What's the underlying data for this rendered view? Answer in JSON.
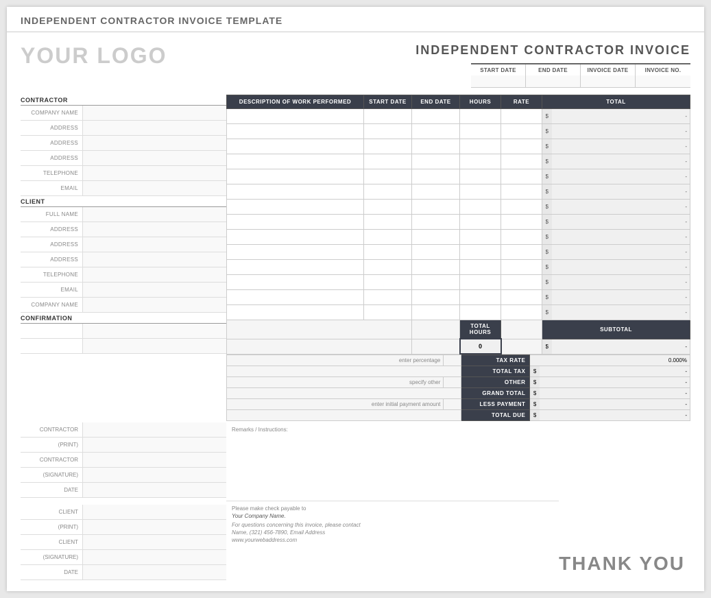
{
  "page": {
    "title": "INDEPENDENT CONTRACTOR INVOICE TEMPLATE"
  },
  "header": {
    "logo": "YOUR LOGO",
    "invoice_title": "INDEPENDENT CONTRACTOR INVOICE",
    "date_labels": [
      "START DATE",
      "END DATE",
      "INVOICE DATE",
      "INVOICE NO."
    ]
  },
  "contractor": {
    "section_label": "CONTRACTOR",
    "fields": [
      {
        "label": "COMPANY NAME",
        "value": ""
      },
      {
        "label": "ADDRESS",
        "value": ""
      },
      {
        "label": "ADDRESS",
        "value": ""
      },
      {
        "label": "ADDRESS",
        "value": ""
      },
      {
        "label": "TELEPHONE",
        "value": ""
      },
      {
        "label": "EMAIL",
        "value": ""
      }
    ]
  },
  "client": {
    "section_label": "CLIENT",
    "fields": [
      {
        "label": "FULL NAME",
        "value": ""
      },
      {
        "label": "ADDRESS",
        "value": ""
      },
      {
        "label": "ADDRESS",
        "value": ""
      },
      {
        "label": "ADDRESS",
        "value": ""
      },
      {
        "label": "TELEPHONE",
        "value": ""
      },
      {
        "label": "EMAIL",
        "value": ""
      },
      {
        "label": "COMPANY NAME",
        "value": ""
      }
    ]
  },
  "work_table": {
    "headers": [
      "DESCRIPTION OF WORK PERFORMED",
      "START DATE",
      "END DATE",
      "HOURS",
      "RATE",
      "TOTAL"
    ],
    "rows": 14
  },
  "summary": {
    "total_hours_label": "TOTAL HOURS",
    "total_hours_value": "0",
    "subtotal_label": "SUBTOTAL",
    "subtotal_dollar": "$",
    "subtotal_value": "-",
    "tax_note": "enter percentage",
    "tax_rate_label": "TAX RATE",
    "tax_rate_value": "0.000%",
    "total_tax_label": "TOTAL TAX",
    "total_tax_dollar": "$",
    "total_tax_value": "-",
    "other_note": "specify other",
    "other_label": "OTHER",
    "other_dollar": "$",
    "other_value": "-",
    "grand_total_label": "GRAND TOTAL",
    "grand_total_dollar": "$",
    "grand_total_value": "-",
    "less_payment_label": "LESS PAYMENT",
    "less_payment_note": "enter initial payment amount",
    "less_payment_dollar": "$",
    "less_payment_value": "-",
    "total_due_label": "TOTAL DUE",
    "total_due_dollar": "$",
    "total_due_value": "-"
  },
  "confirmation": {
    "section_label": "CONFIRMATION",
    "contractor_fields": [
      {
        "label": "CONTRACTOR",
        "value": ""
      },
      {
        "label": "(PRINT)",
        "value": ""
      },
      {
        "label": "CONTRACTOR",
        "value": ""
      },
      {
        "label": "(SIGNATURE)",
        "value": ""
      },
      {
        "label": "DATE",
        "value": ""
      }
    ],
    "client_fields": [
      {
        "label": "CLIENT",
        "value": ""
      },
      {
        "label": "(PRINT)",
        "value": ""
      },
      {
        "label": "CLIENT",
        "value": ""
      },
      {
        "label": "(SIGNATURE)",
        "value": ""
      },
      {
        "label": "DATE",
        "value": ""
      }
    ],
    "remarks_label": "Remarks / Instructions:",
    "payment_line1": "Please make check payable to",
    "payment_line2": "Your Company Name.",
    "payment_line3": "For questions concerning this invoice, please contact",
    "payment_line4": "Name, (321) 456-7890, Email Address",
    "payment_line5": "www.yourwebaddress.com"
  },
  "footer": {
    "thank_you": "THANK YOU"
  }
}
